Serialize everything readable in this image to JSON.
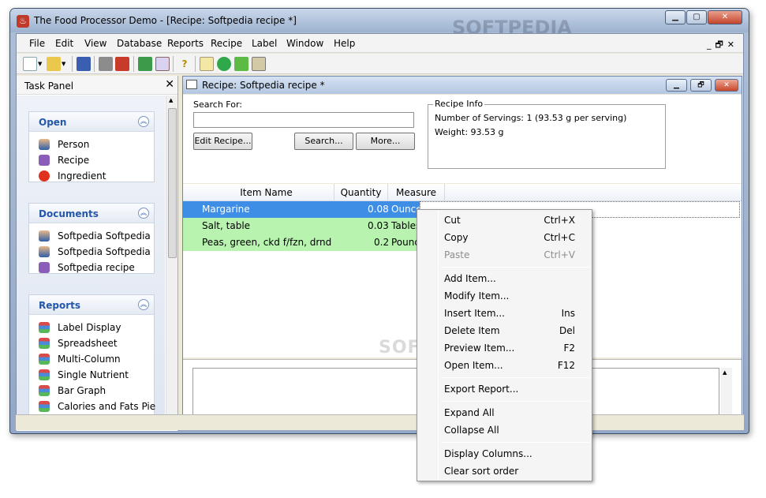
{
  "window": {
    "title": "The Food Processor Demo - [Recipe: Softpedia recipe *]",
    "caption_buttons": [
      "minimize",
      "maximize",
      "close"
    ]
  },
  "menubar": {
    "items": [
      "File",
      "Edit",
      "View",
      "Database",
      "Reports",
      "Recipe",
      "Label",
      "Window",
      "Help"
    ],
    "mdi_controls": [
      "minimize",
      "restore",
      "close"
    ]
  },
  "toolbar": {
    "buttons": [
      "new-icon",
      "new-dropdown-icon",
      "open-icon",
      "open-dropdown-icon",
      "save-icon",
      "print-icon",
      "pdf-icon",
      "export-icon",
      "report-icon",
      "help-icon",
      "edit-icon",
      "play-icon",
      "folder-icon",
      "clipboard-icon"
    ]
  },
  "task_panel": {
    "title": "Task Panel",
    "groups": [
      {
        "title": "Open",
        "items": [
          {
            "label": "Person",
            "icon": "person-icon"
          },
          {
            "label": "Recipe",
            "icon": "recipe-book-icon"
          },
          {
            "label": "Ingredient",
            "icon": "tomato-icon"
          }
        ]
      },
      {
        "title": "Documents",
        "items": [
          {
            "label": "Softpedia Softpedia",
            "icon": "person-icon"
          },
          {
            "label": "Softpedia Softpedia",
            "icon": "person-icon"
          },
          {
            "label": "Softpedia recipe",
            "icon": "recipe-book-icon"
          }
        ]
      },
      {
        "title": "Reports",
        "items": [
          {
            "label": "Label Display",
            "icon": "report-icon"
          },
          {
            "label": "Spreadsheet",
            "icon": "report-icon"
          },
          {
            "label": "Multi-Column",
            "icon": "report-icon"
          },
          {
            "label": "Single Nutrient",
            "icon": "report-icon"
          },
          {
            "label": "Bar Graph",
            "icon": "report-icon"
          },
          {
            "label": "Calories and Fats Pie",
            "icon": "report-icon"
          }
        ]
      }
    ]
  },
  "child": {
    "title": "Recipe: Softpedia recipe *",
    "search_label": "Search For:",
    "search_value": "",
    "buttons": {
      "edit": "Edit Recipe...",
      "search": "Search...",
      "more": "More..."
    },
    "recipe_info": {
      "legend": "Recipe Info",
      "servings": "Number of Servings: 1  (93.53 g per serving)",
      "weight": "Weight: 93.53 g"
    },
    "grid": {
      "columns": [
        "Item Name",
        "Quantity",
        "Measure"
      ],
      "rows": [
        {
          "name": "Margarine",
          "qty": "0.08",
          "measure": "Ounce-w",
          "state": "selected"
        },
        {
          "name": "Salt, table",
          "qty": "0.03",
          "measure": "Tables",
          "state": "green"
        },
        {
          "name": "Peas, green, ckd f/fzn, drnd",
          "qty": "0.2",
          "measure": "Pound",
          "state": "green"
        }
      ]
    }
  },
  "context_menu": {
    "items": [
      {
        "label": "Cut",
        "shortcut": "Ctrl+X",
        "enabled": true
      },
      {
        "label": "Copy",
        "shortcut": "Ctrl+C",
        "enabled": true
      },
      {
        "label": "Paste",
        "shortcut": "Ctrl+V",
        "enabled": false
      },
      {
        "sep": true
      },
      {
        "label": "Add Item...",
        "shortcut": "",
        "enabled": true
      },
      {
        "label": "Modify Item...",
        "shortcut": "",
        "enabled": true
      },
      {
        "label": "Insert Item...",
        "shortcut": "Ins",
        "enabled": true
      },
      {
        "label": "Delete Item",
        "shortcut": "Del",
        "enabled": true
      },
      {
        "label": "Preview Item...",
        "shortcut": "F2",
        "enabled": true
      },
      {
        "label": "Open Item...",
        "shortcut": "F12",
        "enabled": true
      },
      {
        "sep": true
      },
      {
        "label": "Export Report...",
        "shortcut": "",
        "enabled": true
      },
      {
        "sep": true
      },
      {
        "label": "Expand All",
        "shortcut": "",
        "enabled": true
      },
      {
        "label": "Collapse All",
        "shortcut": "",
        "enabled": true
      },
      {
        "sep": true
      },
      {
        "label": "Display Columns...",
        "shortcut": "",
        "enabled": true
      },
      {
        "label": "Clear sort order",
        "shortcut": "",
        "enabled": true
      }
    ]
  },
  "colors": {
    "selected_row": "#3f8ee6",
    "green_row": "#b8f4b0",
    "group_title": "#2457a8"
  },
  "watermark": {
    "mid": "SOFTPEDIA",
    "top": "SOFTPEDIA"
  }
}
